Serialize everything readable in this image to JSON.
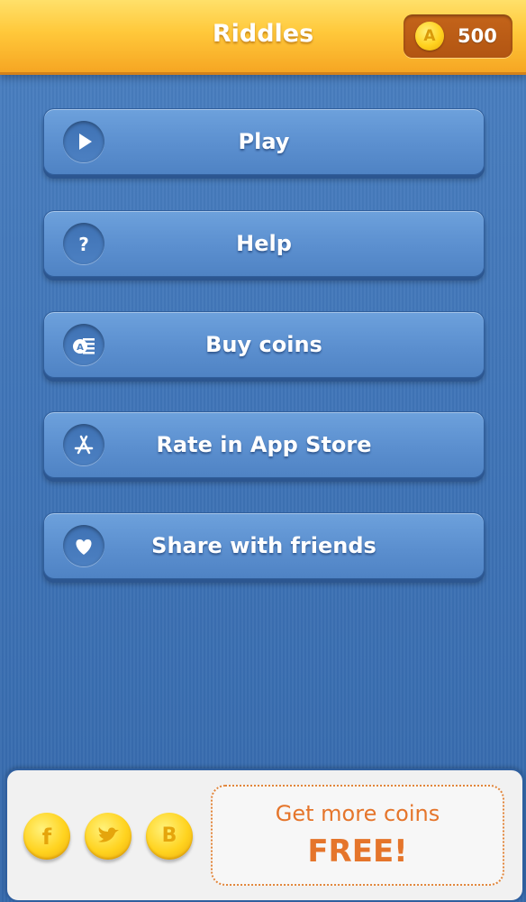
{
  "header": {
    "title": "Riddles",
    "coin_icon_letter": "A",
    "coin_count": "500"
  },
  "menu": [
    {
      "label": "Play",
      "icon": "play-icon"
    },
    {
      "label": "Help",
      "icon": "question-icon"
    },
    {
      "label": "Buy coins",
      "icon": "coins-icon"
    },
    {
      "label": "Rate in App Store",
      "icon": "app-store-icon"
    },
    {
      "label": "Share with friends",
      "icon": "heart-icon"
    }
  ],
  "social": [
    {
      "name": "facebook",
      "icon": "facebook-icon"
    },
    {
      "name": "twitter",
      "icon": "twitter-icon"
    },
    {
      "name": "b",
      "icon": "b-icon",
      "glyph": "B"
    }
  ],
  "promo": {
    "line1": "Get more coins",
    "line2": "FREE!"
  },
  "colors": {
    "header": "#ffc83a",
    "background": "#3f74b7",
    "button": "#5b8fcf",
    "promo_text": "#e5752b",
    "coin": "#ffd21f"
  }
}
